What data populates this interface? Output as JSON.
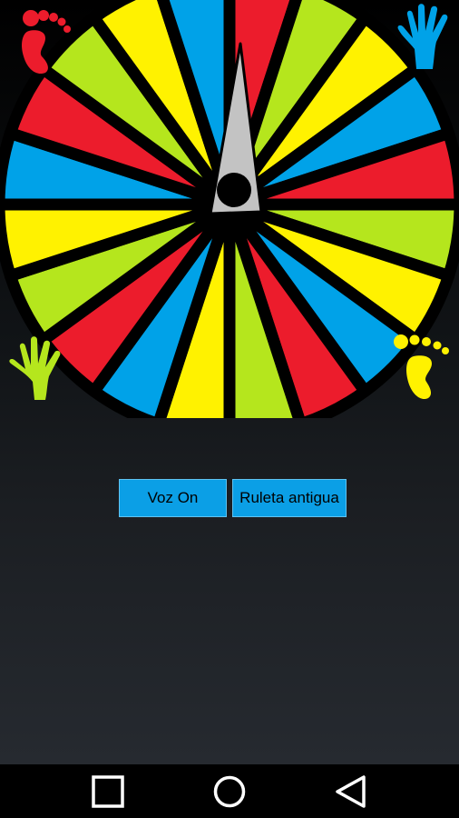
{
  "wheel": {
    "segment_colors": [
      "#ec1c2c",
      "#b5e61d",
      "#fff200",
      "#00a2e8"
    ],
    "pointer_color": "#c3c3c3",
    "separator_color": "#000000",
    "segment_count": 20
  },
  "corners": {
    "top_left": {
      "icon": "foot-icon",
      "color": "#ec1c2c"
    },
    "top_right": {
      "icon": "hand-icon",
      "color": "#00a2e8"
    },
    "bottom_left": {
      "icon": "hand-icon",
      "color": "#b5e61d"
    },
    "bottom_right": {
      "icon": "foot-icon",
      "color": "#fff200"
    }
  },
  "buttons": {
    "voice_label": "Voz On",
    "old_wheel_label": "Ruleta antigua"
  },
  "navbar": {
    "recents_icon": "square-icon",
    "home_icon": "circle-icon",
    "back_icon": "triangle-back-icon"
  }
}
